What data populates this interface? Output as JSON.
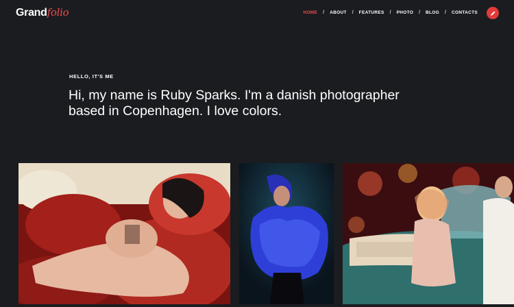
{
  "brand": {
    "name_main": "Grand",
    "name_accent": "folio",
    "accent_color": "#ef4b4b"
  },
  "nav": {
    "items": [
      {
        "label": "HOME",
        "active": true
      },
      {
        "label": "ABOUT",
        "active": false
      },
      {
        "label": "FEATURES",
        "active": false
      },
      {
        "label": "PHOTO",
        "active": false
      },
      {
        "label": "BLOG",
        "active": false
      },
      {
        "label": "CONTACTS",
        "active": false
      }
    ],
    "separator": "/",
    "action_icon": "pencil-icon"
  },
  "intro": {
    "eyebrow": "HELLO, IT'S ME",
    "line1": "Hi, my name is Ruby Sparks. I'm a danish photographer",
    "line2": "based in Copenhagen. I love colors."
  },
  "gallery": {
    "items": [
      {
        "icon": "photo-woman-red-sofa"
      },
      {
        "icon": "photo-woman-blue-fur"
      },
      {
        "icon": "photo-couple-vintage-car"
      }
    ]
  },
  "colors": {
    "background": "#1b1c20",
    "accent": "#ef4b4b",
    "button": "#e33a3a"
  }
}
